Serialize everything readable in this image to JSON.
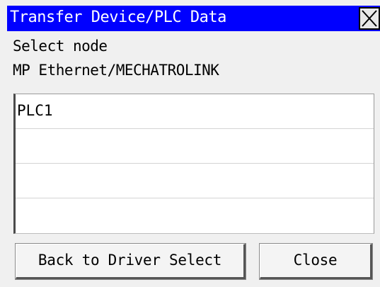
{
  "window": {
    "title": "Transfer Device/PLC Data",
    "accent_color": "#0000ff",
    "close_icon": "close-x-icon"
  },
  "prompt": {
    "line1": "Select node",
    "line2": "MP Ethernet/MECHATROLINK"
  },
  "node_list": {
    "items": [
      "PLC1",
      "",
      "",
      ""
    ]
  },
  "buttons": {
    "back_label": "Back to Driver Select",
    "close_label": "Close"
  }
}
